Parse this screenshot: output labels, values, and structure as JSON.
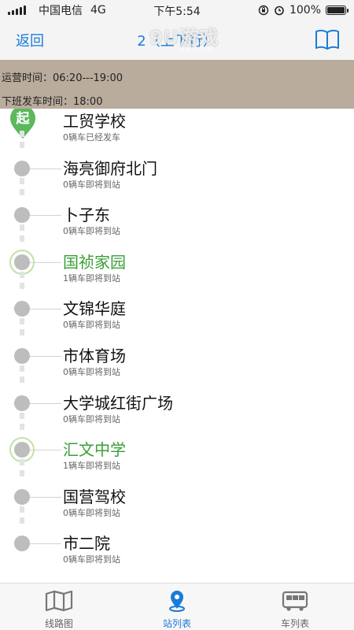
{
  "status_bar": {
    "carrier": "中国电信",
    "network": "4G",
    "time": "下午5:54",
    "battery": "100%",
    "battery_level": 1.0
  },
  "nav": {
    "back_label": "返回",
    "title": "2（上下行）",
    "watermark": "9U游戏",
    "watermark_small": "9u.com"
  },
  "info": {
    "operating_hours": "运营时间：06:20---19:00",
    "last_bus": "下班发车时间：18:00"
  },
  "stations": [
    {
      "name": "工贸学校",
      "status": "0辆车已经发车",
      "is_start": true,
      "start_label": "起",
      "active": false
    },
    {
      "name": "海亮御府北门",
      "status": "0辆车即将到站",
      "active": false
    },
    {
      "name": "卜子东",
      "status": "0辆车即将到站",
      "active": false
    },
    {
      "name": "国祯家园",
      "status": "1辆车即将到站",
      "active": true
    },
    {
      "name": "文锦华庭",
      "status": "0辆车即将到站",
      "active": false
    },
    {
      "name": "市体育场",
      "status": "0辆车即将到站",
      "active": false
    },
    {
      "name": "大学城红街广场",
      "status": "0辆车即将到站",
      "active": false
    },
    {
      "name": "汇文中学",
      "status": "1辆车即将到站",
      "active": true
    },
    {
      "name": "国营驾校",
      "status": "0辆车即将到站",
      "active": false
    },
    {
      "name": "市二院",
      "status": "0辆车即将到站",
      "active": false
    }
  ],
  "tabs": [
    {
      "label": "线路图",
      "icon": "map-icon",
      "active": false
    },
    {
      "label": "站列表",
      "icon": "location-pin-icon",
      "active": true
    },
    {
      "label": "车列表",
      "icon": "bus-icon",
      "active": false
    }
  ],
  "colors": {
    "accent": "#1b7bd8",
    "active_station": "#3a9e37",
    "info_band": "#b9ac9c"
  }
}
